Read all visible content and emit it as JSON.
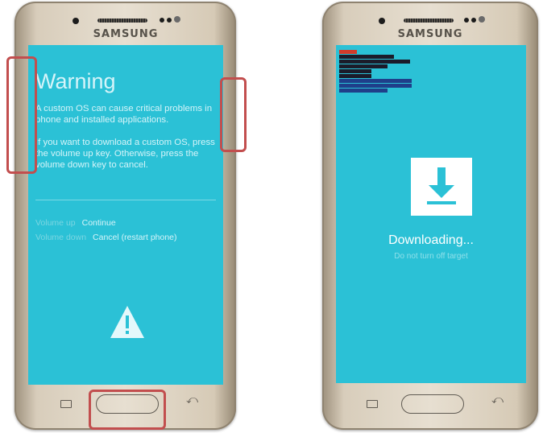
{
  "left_phone": {
    "brand": "SAMSUNG",
    "title": "Warning",
    "para1": "A custom OS can cause critical problems in phone and installed applications.",
    "para2": "If you want to download a custom OS, press the volume up key. Otherwise, press the volume down key to cancel.",
    "options": [
      {
        "key": "Volume up",
        "action": "Continue"
      },
      {
        "key": "Volume down",
        "action": "Cancel (restart phone)"
      }
    ],
    "icon": "warning-triangle-icon"
  },
  "right_phone": {
    "brand": "SAMSUNG",
    "status": "Downloading...",
    "note": "Do not turn off target",
    "icon": "download-arrow-icon"
  },
  "colors": {
    "screen": "#2bc1d6",
    "highlight": "#c24e4e",
    "body": "#e3dac9"
  }
}
